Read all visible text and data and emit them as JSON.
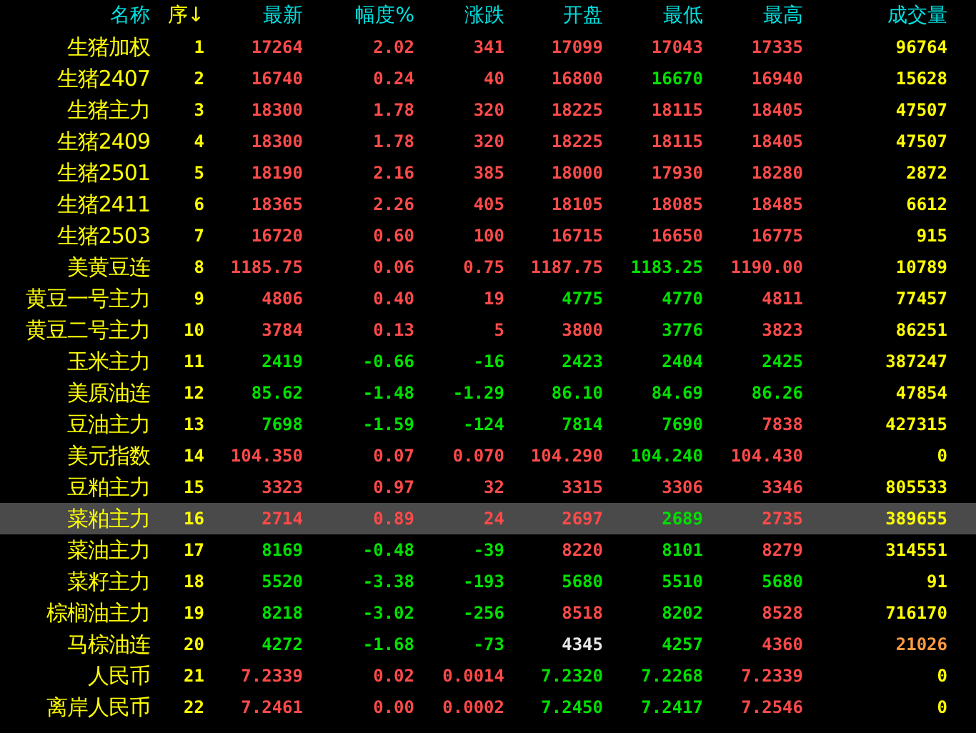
{
  "columns": [
    {
      "label": "名称",
      "sorted": false
    },
    {
      "label": "序",
      "sorted": true,
      "sort_arrow": "↓"
    },
    {
      "label": "最新",
      "sorted": false
    },
    {
      "label": "幅度%",
      "sorted": false
    },
    {
      "label": "涨跌",
      "sorted": false
    },
    {
      "label": "开盘",
      "sorted": false
    },
    {
      "label": "最低",
      "sorted": false
    },
    {
      "label": "最高",
      "sorted": false
    },
    {
      "label": "成交量",
      "sorted": false
    }
  ],
  "rows": [
    {
      "name": "生猪加权",
      "no": "1",
      "selected": false,
      "cells": [
        {
          "text": "17264",
          "color": "#ff4a4a"
        },
        {
          "text": "2.02",
          "color": "#ff4a4a"
        },
        {
          "text": "341",
          "color": "#ff4a4a"
        },
        {
          "text": "17099",
          "color": "#ff4a4a"
        },
        {
          "text": "17043",
          "color": "#ff4a4a"
        },
        {
          "text": "17335",
          "color": "#ff4a4a"
        },
        {
          "text": "96764",
          "color": "#ffff00"
        }
      ]
    },
    {
      "name": "生猪2407",
      "no": "2",
      "selected": false,
      "cells": [
        {
          "text": "16740",
          "color": "#ff4a4a"
        },
        {
          "text": "0.24",
          "color": "#ff4a4a"
        },
        {
          "text": "40",
          "color": "#ff4a4a"
        },
        {
          "text": "16800",
          "color": "#ff4a4a"
        },
        {
          "text": "16670",
          "color": "#00e000"
        },
        {
          "text": "16940",
          "color": "#ff4a4a"
        },
        {
          "text": "15628",
          "color": "#ffff00"
        }
      ]
    },
    {
      "name": "生猪主力",
      "no": "3",
      "selected": false,
      "cells": [
        {
          "text": "18300",
          "color": "#ff4a4a"
        },
        {
          "text": "1.78",
          "color": "#ff4a4a"
        },
        {
          "text": "320",
          "color": "#ff4a4a"
        },
        {
          "text": "18225",
          "color": "#ff4a4a"
        },
        {
          "text": "18115",
          "color": "#ff4a4a"
        },
        {
          "text": "18405",
          "color": "#ff4a4a"
        },
        {
          "text": "47507",
          "color": "#ffff00"
        }
      ]
    },
    {
      "name": "生猪2409",
      "no": "4",
      "selected": false,
      "cells": [
        {
          "text": "18300",
          "color": "#ff4a4a"
        },
        {
          "text": "1.78",
          "color": "#ff4a4a"
        },
        {
          "text": "320",
          "color": "#ff4a4a"
        },
        {
          "text": "18225",
          "color": "#ff4a4a"
        },
        {
          "text": "18115",
          "color": "#ff4a4a"
        },
        {
          "text": "18405",
          "color": "#ff4a4a"
        },
        {
          "text": "47507",
          "color": "#ffff00"
        }
      ]
    },
    {
      "name": "生猪2501",
      "no": "5",
      "selected": false,
      "cells": [
        {
          "text": "18190",
          "color": "#ff4a4a"
        },
        {
          "text": "2.16",
          "color": "#ff4a4a"
        },
        {
          "text": "385",
          "color": "#ff4a4a"
        },
        {
          "text": "18000",
          "color": "#ff4a4a"
        },
        {
          "text": "17930",
          "color": "#ff4a4a"
        },
        {
          "text": "18280",
          "color": "#ff4a4a"
        },
        {
          "text": "2872",
          "color": "#ffff00"
        }
      ]
    },
    {
      "name": "生猪2411",
      "no": "6",
      "selected": false,
      "cells": [
        {
          "text": "18365",
          "color": "#ff4a4a"
        },
        {
          "text": "2.26",
          "color": "#ff4a4a"
        },
        {
          "text": "405",
          "color": "#ff4a4a"
        },
        {
          "text": "18105",
          "color": "#ff4a4a"
        },
        {
          "text": "18085",
          "color": "#ff4a4a"
        },
        {
          "text": "18485",
          "color": "#ff4a4a"
        },
        {
          "text": "6612",
          "color": "#ffff00"
        }
      ]
    },
    {
      "name": "生猪2503",
      "no": "7",
      "selected": false,
      "cells": [
        {
          "text": "16720",
          "color": "#ff4a4a"
        },
        {
          "text": "0.60",
          "color": "#ff4a4a"
        },
        {
          "text": "100",
          "color": "#ff4a4a"
        },
        {
          "text": "16715",
          "color": "#ff4a4a"
        },
        {
          "text": "16650",
          "color": "#ff4a4a"
        },
        {
          "text": "16775",
          "color": "#ff4a4a"
        },
        {
          "text": "915",
          "color": "#ffff00"
        }
      ]
    },
    {
      "name": "美黄豆连",
      "no": "8",
      "selected": false,
      "cells": [
        {
          "text": "1185.75",
          "color": "#ff4a4a"
        },
        {
          "text": "0.06",
          "color": "#ff4a4a"
        },
        {
          "text": "0.75",
          "color": "#ff4a4a"
        },
        {
          "text": "1187.75",
          "color": "#ff4a4a"
        },
        {
          "text": "1183.25",
          "color": "#00e000"
        },
        {
          "text": "1190.00",
          "color": "#ff4a4a"
        },
        {
          "text": "10789",
          "color": "#ffff00"
        }
      ]
    },
    {
      "name": "黄豆一号主力",
      "no": "9",
      "selected": false,
      "cells": [
        {
          "text": "4806",
          "color": "#ff4a4a"
        },
        {
          "text": "0.40",
          "color": "#ff4a4a"
        },
        {
          "text": "19",
          "color": "#ff4a4a"
        },
        {
          "text": "4775",
          "color": "#00e000"
        },
        {
          "text": "4770",
          "color": "#00e000"
        },
        {
          "text": "4811",
          "color": "#ff4a4a"
        },
        {
          "text": "77457",
          "color": "#ffff00"
        }
      ]
    },
    {
      "name": "黄豆二号主力",
      "no": "10",
      "selected": false,
      "cells": [
        {
          "text": "3784",
          "color": "#ff4a4a"
        },
        {
          "text": "0.13",
          "color": "#ff4a4a"
        },
        {
          "text": "5",
          "color": "#ff4a4a"
        },
        {
          "text": "3800",
          "color": "#ff4a4a"
        },
        {
          "text": "3776",
          "color": "#00e000"
        },
        {
          "text": "3823",
          "color": "#ff4a4a"
        },
        {
          "text": "86251",
          "color": "#ffff00"
        }
      ]
    },
    {
      "name": "玉米主力",
      "no": "11",
      "selected": false,
      "cells": [
        {
          "text": "2419",
          "color": "#00e000"
        },
        {
          "text": "-0.66",
          "color": "#00e000"
        },
        {
          "text": "-16",
          "color": "#00e000"
        },
        {
          "text": "2423",
          "color": "#00e000"
        },
        {
          "text": "2404",
          "color": "#00e000"
        },
        {
          "text": "2425",
          "color": "#00e000"
        },
        {
          "text": "387247",
          "color": "#ffff00"
        }
      ]
    },
    {
      "name": "美原油连",
      "no": "12",
      "selected": false,
      "cells": [
        {
          "text": "85.62",
          "color": "#00e000"
        },
        {
          "text": "-1.48",
          "color": "#00e000"
        },
        {
          "text": "-1.29",
          "color": "#00e000"
        },
        {
          "text": "86.10",
          "color": "#00e000"
        },
        {
          "text": "84.69",
          "color": "#00e000"
        },
        {
          "text": "86.26",
          "color": "#00e000"
        },
        {
          "text": "47854",
          "color": "#ffff00"
        }
      ]
    },
    {
      "name": "豆油主力",
      "no": "13",
      "selected": false,
      "cells": [
        {
          "text": "7698",
          "color": "#00e000"
        },
        {
          "text": "-1.59",
          "color": "#00e000"
        },
        {
          "text": "-124",
          "color": "#00e000"
        },
        {
          "text": "7814",
          "color": "#00e000"
        },
        {
          "text": "7690",
          "color": "#00e000"
        },
        {
          "text": "7838",
          "color": "#ff4a4a"
        },
        {
          "text": "427315",
          "color": "#ffff00"
        }
      ]
    },
    {
      "name": "美元指数",
      "no": "14",
      "selected": false,
      "cells": [
        {
          "text": "104.350",
          "color": "#ff4a4a"
        },
        {
          "text": "0.07",
          "color": "#ff4a4a"
        },
        {
          "text": "0.070",
          "color": "#ff4a4a"
        },
        {
          "text": "104.290",
          "color": "#ff4a4a"
        },
        {
          "text": "104.240",
          "color": "#00e000"
        },
        {
          "text": "104.430",
          "color": "#ff4a4a"
        },
        {
          "text": "0",
          "color": "#ffff00"
        }
      ]
    },
    {
      "name": "豆粕主力",
      "no": "15",
      "selected": false,
      "cells": [
        {
          "text": "3323",
          "color": "#ff4a4a"
        },
        {
          "text": "0.97",
          "color": "#ff4a4a"
        },
        {
          "text": "32",
          "color": "#ff4a4a"
        },
        {
          "text": "3315",
          "color": "#ff4a4a"
        },
        {
          "text": "3306",
          "color": "#ff4a4a"
        },
        {
          "text": "3346",
          "color": "#ff4a4a"
        },
        {
          "text": "805533",
          "color": "#ffff00"
        }
      ]
    },
    {
      "name": "菜粕主力",
      "no": "16",
      "selected": true,
      "cells": [
        {
          "text": "2714",
          "color": "#ff4a4a"
        },
        {
          "text": "0.89",
          "color": "#ff4a4a"
        },
        {
          "text": "24",
          "color": "#ff4a4a"
        },
        {
          "text": "2697",
          "color": "#ff4a4a"
        },
        {
          "text": "2689",
          "color": "#00e000"
        },
        {
          "text": "2735",
          "color": "#ff4a4a"
        },
        {
          "text": "389655",
          "color": "#ffff00"
        }
      ]
    },
    {
      "name": "菜油主力",
      "no": "17",
      "selected": false,
      "cells": [
        {
          "text": "8169",
          "color": "#00e000"
        },
        {
          "text": "-0.48",
          "color": "#00e000"
        },
        {
          "text": "-39",
          "color": "#00e000"
        },
        {
          "text": "8220",
          "color": "#ff4a4a"
        },
        {
          "text": "8101",
          "color": "#00e000"
        },
        {
          "text": "8279",
          "color": "#ff4a4a"
        },
        {
          "text": "314551",
          "color": "#ffff00"
        }
      ]
    },
    {
      "name": "菜籽主力",
      "no": "18",
      "selected": false,
      "cells": [
        {
          "text": "5520",
          "color": "#00e000"
        },
        {
          "text": "-3.38",
          "color": "#00e000"
        },
        {
          "text": "-193",
          "color": "#00e000"
        },
        {
          "text": "5680",
          "color": "#00e000"
        },
        {
          "text": "5510",
          "color": "#00e000"
        },
        {
          "text": "5680",
          "color": "#00e000"
        },
        {
          "text": "91",
          "color": "#ffff00"
        }
      ]
    },
    {
      "name": "棕榈油主力",
      "no": "19",
      "selected": false,
      "cells": [
        {
          "text": "8218",
          "color": "#00e000"
        },
        {
          "text": "-3.02",
          "color": "#00e000"
        },
        {
          "text": "-256",
          "color": "#00e000"
        },
        {
          "text": "8518",
          "color": "#ff4a4a"
        },
        {
          "text": "8202",
          "color": "#00e000"
        },
        {
          "text": "8528",
          "color": "#ff4a4a"
        },
        {
          "text": "716170",
          "color": "#ffff00"
        }
      ]
    },
    {
      "name": "马棕油连",
      "no": "20",
      "selected": false,
      "cells": [
        {
          "text": "4272",
          "color": "#00e000"
        },
        {
          "text": "-1.68",
          "color": "#00e000"
        },
        {
          "text": "-73",
          "color": "#00e000"
        },
        {
          "text": "4345",
          "color": "#e8e8e8"
        },
        {
          "text": "4257",
          "color": "#00e000"
        },
        {
          "text": "4360",
          "color": "#ff4a4a"
        },
        {
          "text": "21026",
          "color": "#ff9a40"
        }
      ]
    },
    {
      "name": "人民币",
      "no": "21",
      "selected": false,
      "cells": [
        {
          "text": "7.2339",
          "color": "#ff4a4a"
        },
        {
          "text": "0.02",
          "color": "#ff4a4a"
        },
        {
          "text": "0.0014",
          "color": "#ff4a4a"
        },
        {
          "text": "7.2320",
          "color": "#00e000"
        },
        {
          "text": "7.2268",
          "color": "#00e000"
        },
        {
          "text": "7.2339",
          "color": "#ff4a4a"
        },
        {
          "text": "0",
          "color": "#ffff00"
        }
      ]
    },
    {
      "name": "离岸人民币",
      "no": "22",
      "selected": false,
      "cells": [
        {
          "text": "7.2461",
          "color": "#ff4a4a"
        },
        {
          "text": "0.00",
          "color": "#ff4a4a"
        },
        {
          "text": "0.0002",
          "color": "#ff4a4a"
        },
        {
          "text": "7.2450",
          "color": "#00e000"
        },
        {
          "text": "7.2417",
          "color": "#00e000"
        },
        {
          "text": "7.2546",
          "color": "#ff4a4a"
        },
        {
          "text": "0",
          "color": "#ffff00"
        }
      ]
    }
  ]
}
